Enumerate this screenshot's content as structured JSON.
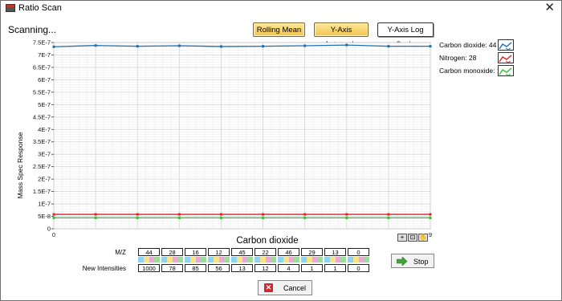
{
  "window": {
    "title": "Ratio Scan",
    "close_glyph": "✕"
  },
  "status_text": "Scanning...",
  "toolbar": {
    "rolling_mean": "Rolling Mean",
    "y_autoscale": "Y-Axis Autoscale",
    "y_log": "Y-Axis Log Scale"
  },
  "legend": [
    {
      "label": "Carbon dioxide: 44",
      "color": "#1f6fb5"
    },
    {
      "label": "Nitrogen: 28",
      "color": "#e0212b"
    },
    {
      "label": "Carbon monoxide: 12",
      "color": "#2fc12f"
    }
  ],
  "chart_data": {
    "type": "line",
    "title": "Carbon dioxide",
    "ylabel": "Mass Spec Response",
    "xlabel": "",
    "xlim": [
      0,
      9
    ],
    "ylim": [
      0,
      7.5e-07
    ],
    "grid": true,
    "y_ticks": [
      "0",
      "5E-8",
      "1E-7",
      "1.5E-7",
      "2E-7",
      "2.5E-7",
      "3E-7",
      "3.5E-7",
      "4E-7",
      "4.5E-7",
      "5E-7",
      "5.5E-7",
      "6E-7",
      "6.5E-7",
      "7E-7",
      "7.5E-7"
    ],
    "x_ticks": [
      "0",
      "9"
    ],
    "x": [
      0,
      1,
      2,
      3,
      4,
      5,
      6,
      7,
      8,
      9
    ],
    "series": [
      {
        "name": "Carbon dioxide: 44",
        "color": "#1f6fb5",
        "values": [
          7.33e-07,
          7.38e-07,
          7.35e-07,
          7.37e-07,
          7.34e-07,
          7.35e-07,
          7.37e-07,
          7.4e-07,
          7.35e-07,
          7.35e-07
        ]
      },
      {
        "name": "Nitrogen: 28",
        "color": "#e0212b",
        "values": [
          5.8e-08,
          5.8e-08,
          5.8e-08,
          5.8e-08,
          5.8e-08,
          5.8e-08,
          5.8e-08,
          5.8e-08,
          5.8e-08,
          5.8e-08
        ]
      },
      {
        "name": "Carbon monoxide: 12",
        "color": "#2fc12f",
        "values": [
          4.4e-08,
          4.4e-08,
          4.4e-08,
          4.4e-08,
          4.4e-08,
          4.4e-08,
          4.4e-08,
          4.4e-08,
          4.4e-08,
          4.4e-08
        ]
      }
    ]
  },
  "zoom_tools": [
    "+",
    "⊡",
    "✋"
  ],
  "table": {
    "mz_label": "M/Z",
    "intensities_label": "New Intensities",
    "mz": [
      "44",
      "28",
      "16",
      "12",
      "45",
      "22",
      "46",
      "29",
      "13",
      "0"
    ],
    "intensities": [
      "1000",
      "78",
      "85",
      "56",
      "13",
      "12",
      "4",
      "1",
      "1",
      "0"
    ],
    "swatch_colors": [
      "#8fd3f2",
      "#f7e38a",
      "#e9a6d6",
      "#9ddc9a"
    ]
  },
  "stop_label": "Stop",
  "cancel_label": "Cancel"
}
